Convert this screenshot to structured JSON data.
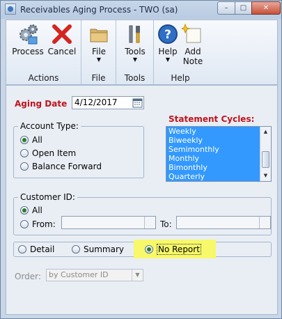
{
  "window": {
    "title": "Receivables Aging Process  -  TWO (sa)",
    "min_glyph": "–",
    "max_glyph": "□",
    "close_glyph": "✕"
  },
  "ribbon": {
    "groups": [
      {
        "label": "Actions",
        "buttons": [
          {
            "label": "Process",
            "icon": "gears-icon"
          },
          {
            "label": "Cancel",
            "icon": "red-x-icon"
          }
        ]
      },
      {
        "label": "File",
        "buttons": [
          {
            "label": "File",
            "icon": "folder-icon"
          }
        ]
      },
      {
        "label": "Tools",
        "buttons": [
          {
            "label": "Tools",
            "icon": "tools-icon"
          }
        ]
      },
      {
        "label": "Help",
        "buttons": [
          {
            "label": "Help",
            "icon": "help-icon"
          },
          {
            "label": "Add\nNote",
            "icon": "note-icon"
          }
        ]
      }
    ],
    "caret": "▼"
  },
  "form": {
    "aging_date_label": "Aging Date",
    "aging_date_value": "4/12/2017",
    "account_type": {
      "title": "Account Type:",
      "options": [
        "All",
        "Open Item",
        "Balance Forward"
      ],
      "selected": "All"
    },
    "statement_cycles": {
      "title": "Statement Cycles:",
      "items": [
        "Weekly",
        "Biweekly",
        "Semimonthly",
        "Monthly",
        "Bimonthly",
        "Quarterly"
      ]
    },
    "customer_id": {
      "title": "Customer ID:",
      "options": [
        "All",
        "From:"
      ],
      "selected": "All",
      "to_label": "To:",
      "from_value": "",
      "to_value": ""
    },
    "report": {
      "options": [
        "Detail",
        "Summary",
        "No Report"
      ],
      "selected": "No Report"
    },
    "order": {
      "label": "Order:",
      "value": "by Customer ID"
    }
  },
  "colors": {
    "accent_red": "#c0141c",
    "list_selection": "#3399ff",
    "highlight": "#f7f86a"
  }
}
